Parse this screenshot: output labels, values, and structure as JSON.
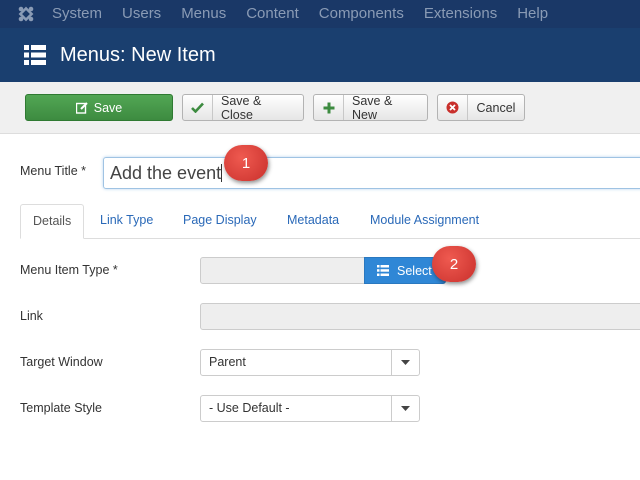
{
  "topnav": {
    "logo_icon": "joomla-logo-icon",
    "items": [
      "System",
      "Users",
      "Menus",
      "Content",
      "Components",
      "Extensions",
      "Help"
    ]
  },
  "header": {
    "icon": "list-icon",
    "title": "Menus: New Item"
  },
  "toolbar": {
    "save_label": "Save",
    "save_close_label": "Save & Close",
    "save_new_label": "Save & New",
    "cancel_label": "Cancel"
  },
  "form": {
    "title_label": "Menu Title *",
    "title_value": "Add the event",
    "tabs": [
      "Details",
      "Link Type",
      "Page Display",
      "Metadata",
      "Module Assignment"
    ],
    "menu_item_type_label": "Menu Item Type *",
    "select_label": "Select",
    "link_label": "Link",
    "target_window_label": "Target Window",
    "target_window_value": "Parent",
    "template_style_label": "Template Style",
    "template_style_value": "- Use Default -"
  },
  "callouts": [
    "1",
    "2"
  ],
  "colors": {
    "topnav": "#1a3867",
    "header": "#1a3f6f",
    "save": "#46a046",
    "select": "#2f87d6",
    "callout": "#d9433c"
  }
}
